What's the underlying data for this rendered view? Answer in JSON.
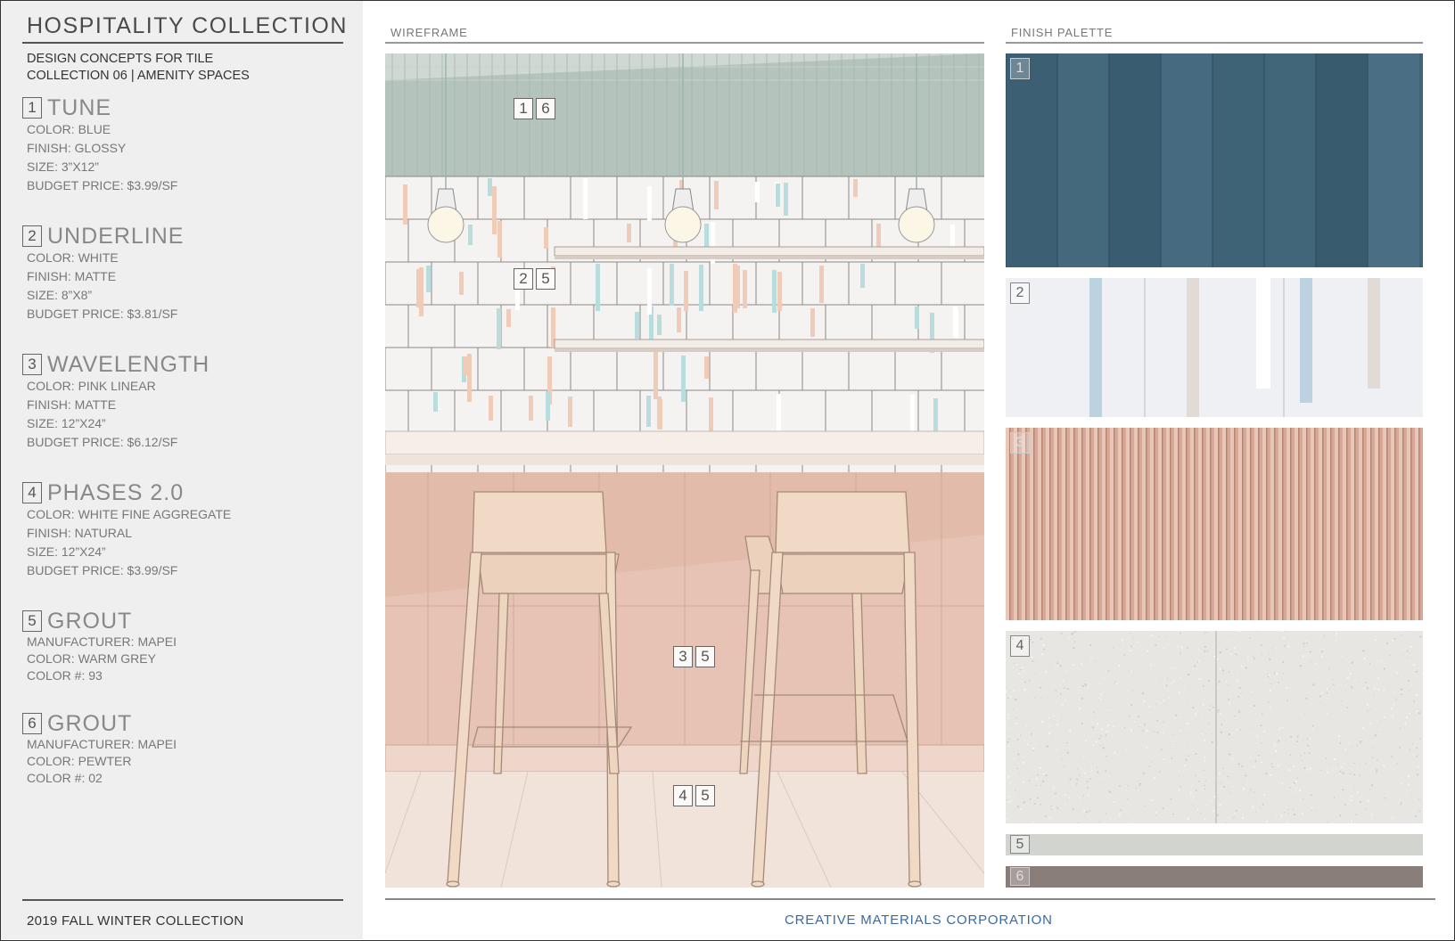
{
  "sidebar": {
    "title": "HOSPITALITY COLLECTION",
    "subtitle_line1": "DESIGN CONCEPTS FOR TILE",
    "subtitle_line2": "COLLECTION 06 | AMENITY SPACES",
    "items": [
      {
        "num": "1",
        "name": "TUNE",
        "lines": [
          "COLOR: BLUE",
          "FINISH: GLOSSY",
          "SIZE: 3”X12”",
          "BUDGET PRICE: $3.99/SF"
        ]
      },
      {
        "num": "2",
        "name": "UNDERLINE",
        "lines": [
          "COLOR: WHITE",
          "FINISH: MATTE",
          "SIZE: 8”X8”",
          "BUDGET PRICE: $3.81/SF"
        ]
      },
      {
        "num": "3",
        "name": "WAVELENGTH",
        "lines": [
          "COLOR: PINK LINEAR",
          "FINISH: MATTE",
          "SIZE: 12”X24”",
          "BUDGET PRICE: $6.12/SF"
        ]
      },
      {
        "num": "4",
        "name": "PHASES 2.0",
        "lines": [
          "COLOR: WHITE FINE AGGREGATE",
          "FINISH: NATURAL",
          "SIZE: 12”X24”",
          "BUDGET PRICE: $3.99/SF"
        ]
      },
      {
        "num": "5",
        "name": "GROUT",
        "lines": [
          "MANUFACTURER: MAPEI",
          "COLOR: WARM GREY",
          "COLOR #: 93"
        ]
      },
      {
        "num": "6",
        "name": "GROUT",
        "lines": [
          "MANUFACTURER: MAPEI",
          "COLOR: PEWTER",
          "COLOR #: 02"
        ]
      }
    ],
    "footer": "2019 FALL WINTER COLLECTION"
  },
  "wireframe": {
    "label": "WIREFRAME",
    "tags": [
      [
        "1",
        "6"
      ],
      [
        "2",
        "5"
      ],
      [
        "3",
        "5"
      ],
      [
        "4",
        "5"
      ]
    ]
  },
  "palette": {
    "label": "FINISH PALETTE",
    "swatches": [
      {
        "num": "1",
        "color": "#3f6377"
      },
      {
        "num": "2",
        "color": "#eef0f3"
      },
      {
        "num": "3",
        "color": "#d6a898"
      },
      {
        "num": "4",
        "color": "#e7e6e2"
      },
      {
        "num": "5",
        "color": "#d2d5cf"
      },
      {
        "num": "6",
        "color": "#8a7e7b"
      }
    ]
  },
  "footer": {
    "brand": "CREATIVE MATERIALS CORPORATION"
  }
}
